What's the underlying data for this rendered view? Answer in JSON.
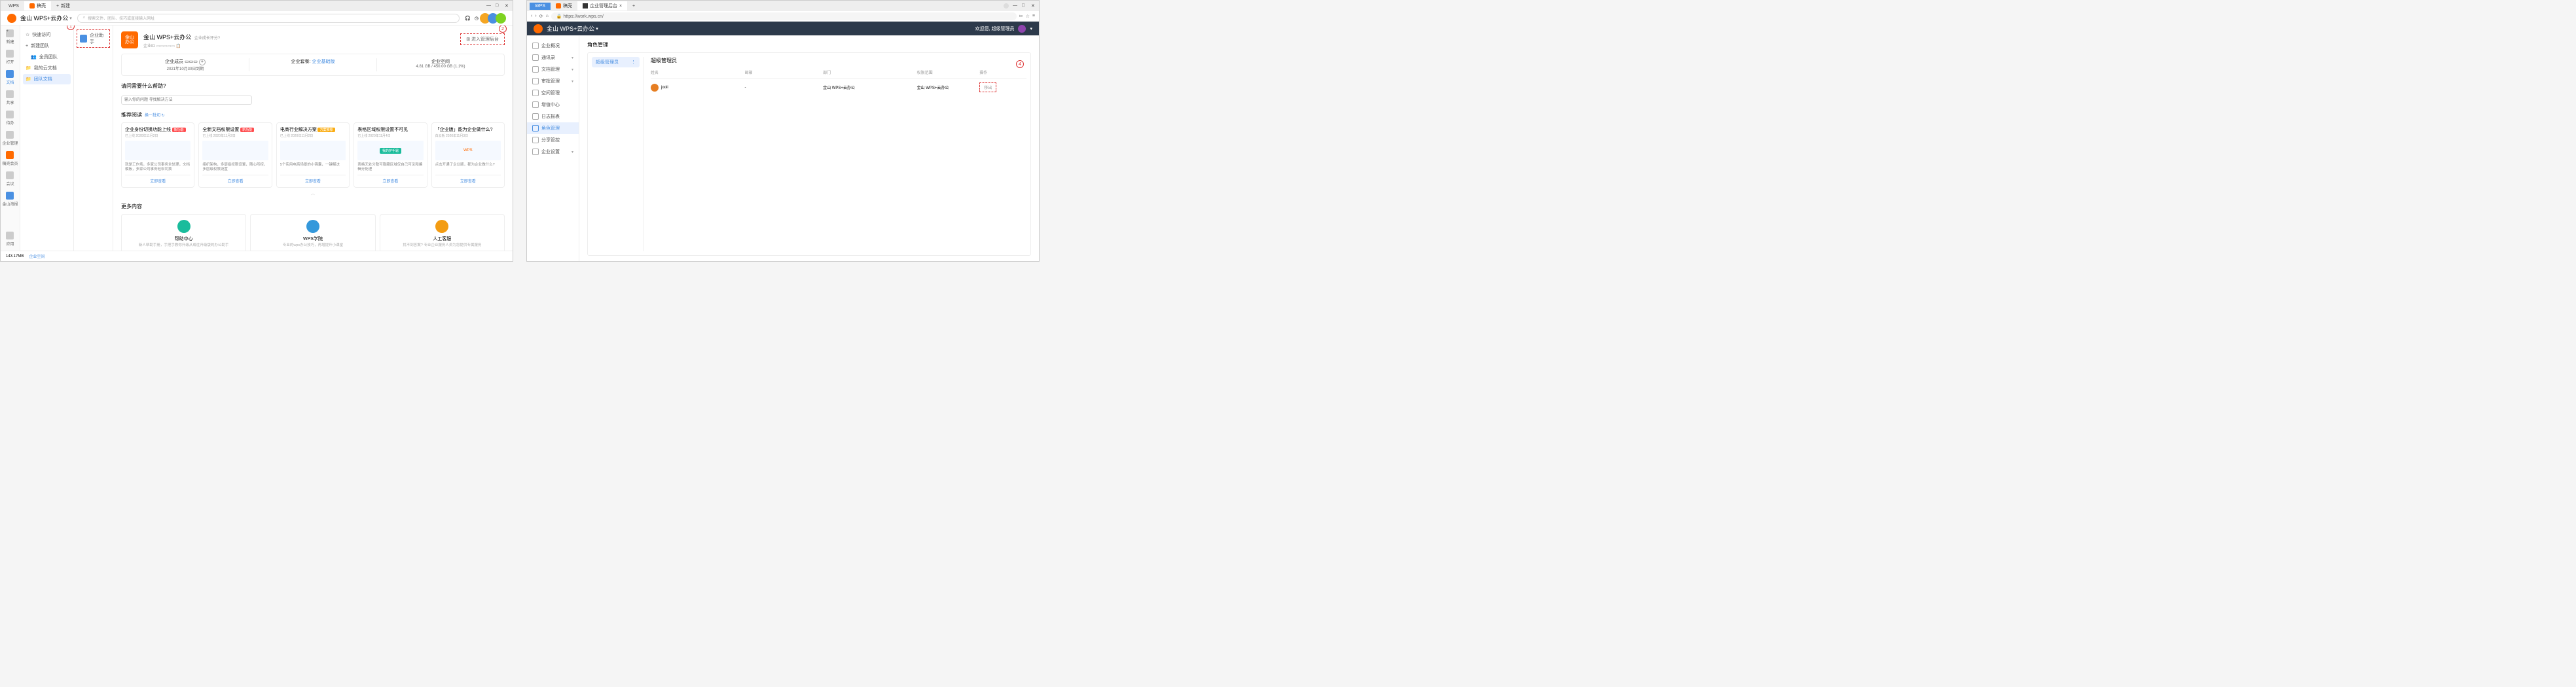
{
  "left": {
    "tabs": {
      "wps": "WPS",
      "liaoku": "稿壳",
      "new": "新建"
    },
    "brand": "金山 WPS+云办公",
    "search_placeholder": "搜索文件、团队、技巧或直接输入网址",
    "rail": {
      "new": "新建",
      "open": "打开",
      "files": "文档",
      "share": "共享",
      "todo": "待办",
      "ent": "企业管理",
      "member": "稿壳会员",
      "meeting": "会议",
      "wps_sea": "金山海报",
      "app": "应用"
    },
    "file_nav": {
      "quick": "快速访问",
      "new_team": "新建团队",
      "all_team": "全员团队",
      "my_docs": "我的云文档",
      "team_docs": "团队文档"
    },
    "sublist": {
      "qyzs": "企业助手"
    },
    "org": {
      "name": "金山 WPS+云办公",
      "growth": "企业成长评分?",
      "id_label": "企业ID"
    },
    "enter_admin": "进入管理后台",
    "stats": {
      "members_label": "企业成员",
      "expire": "2021年10月30日到期",
      "package_label": "企业套餐:",
      "package_value": "企业基础版",
      "space_label": "企业空间",
      "space_value": "4.81 GB / 450.00 GB (1.1%)"
    },
    "help": {
      "title": "请问需要什么帮助?",
      "ph": "输入你的问题 寻找解决方法"
    },
    "recommend": "推荐阅读",
    "recommend_link": "换一批切 ↻",
    "cards": [
      {
        "title": "企业身份切换功能上线",
        "tag": "新功能",
        "date": "已上线 2020年11月2日",
        "desc": "就是工作场，多家公司事务全处理，文档模板，多家公司事务轻松切换",
        "btn": "立即查看"
      },
      {
        "title": "全新文档权限设置",
        "tag": "新功能",
        "date": "已上线 2020年11月2日",
        "desc": "组织架构，多层级权限设置，随心所控，多层级权限设置",
        "btn": "立即查看"
      },
      {
        "title": "电商行业解决方案",
        "tag": "方案推荐",
        "date": "已上线 2020年11月2日",
        "desc": "5个实用电商场景的小锦囊，一键解决",
        "btn": "立即查看"
      },
      {
        "title": "表格区域权限设置不可见",
        "tag": "",
        "date": "已上线 2020年11月4日",
        "desc": "表格无处分散可隐藏区域仅自己可见和编辑分处理",
        "btn": "立即查看"
      },
      {
        "title": "「企业版」能为企业做什么?",
        "tag": "",
        "date": "白云板 2020年11月3日",
        "desc": "点击开通了企业版，都为企业做什么?",
        "btn": "立即查看"
      }
    ],
    "more_title": "更多内容",
    "more_cards": [
      {
        "title": "帮助中心",
        "desc": "新人帮助手册，手把手教你升级从成往升级版的办公助手",
        "color": "#1abc9c"
      },
      {
        "title": "WPS学院",
        "desc": "专业的wps办公技巧，再增提升小课堂",
        "color": "#3498db"
      },
      {
        "title": "人工客服",
        "desc": "找不到答案? 专业企业服务人员为您提供专属服务",
        "color": "#f39c12"
      }
    ],
    "footer": {
      "storage": "143.17MB",
      "ent_space": "企业空间"
    },
    "callouts": {
      "c1": "1",
      "c2": "2"
    }
  },
  "right": {
    "tabs": {
      "wps": "WPS",
      "liaoku": "稿壳",
      "admin": "企业管理后台"
    },
    "url": "https://work.wps.cn/",
    "brand": "金山 WPS+云办公",
    "welcome": "欢迎您, 超级管理员",
    "sidebar": [
      {
        "label": "企业概况"
      },
      {
        "label": "通讯录",
        "chev": true
      },
      {
        "label": "文档管理",
        "chev": true
      },
      {
        "label": "审批管理",
        "chev": true
      },
      {
        "label": "空间管理"
      },
      {
        "label": "增值中心"
      },
      {
        "label": "日志报表"
      },
      {
        "label": "角色管理",
        "active": true
      },
      {
        "label": "分享管控"
      },
      {
        "label": "企业设置",
        "chev": true
      }
    ],
    "page_title": "角色管理",
    "role_tab": "超级管理员",
    "detail_title": "超级管理员",
    "columns": {
      "name": "姓名",
      "email": "邮箱",
      "dept": "部门",
      "scope": "权限范围",
      "op": "操作"
    },
    "row": {
      "name": "jooii",
      "email": "-",
      "dept": "金山 WPS+云办公",
      "scope": "金山 WPS+云办公",
      "op": "移出"
    },
    "callouts": {
      "c3": "3",
      "c4": "4"
    }
  }
}
